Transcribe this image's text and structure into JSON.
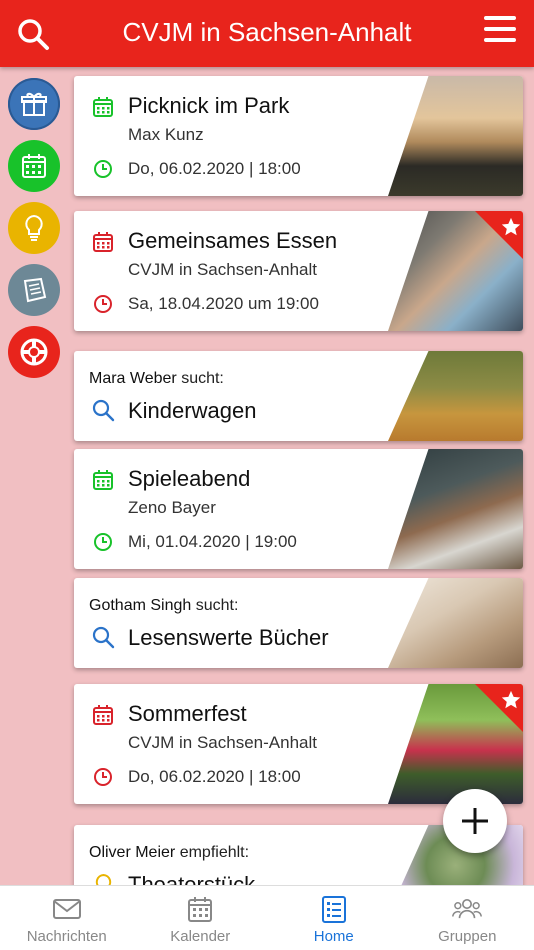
{
  "header": {
    "title": "CVJM in Sachsen-Anhalt",
    "colors": {
      "header_bg": "#e8241c",
      "background": "#f1bfc2"
    }
  },
  "sidebar": [
    {
      "name": "gift-category-button",
      "icon": "gift-icon",
      "color": "#3b74b8"
    },
    {
      "name": "calendar-category-button",
      "icon": "calendar-icon",
      "color": "#18c22a"
    },
    {
      "name": "idea-category-button",
      "icon": "lightbulb-icon",
      "color": "#e9b400"
    },
    {
      "name": "notes-category-button",
      "icon": "notes-icon",
      "color": "#6d8896"
    },
    {
      "name": "help-category-button",
      "icon": "lifebuoy-icon",
      "color": "#e8241c"
    }
  ],
  "feed": {
    "event1": {
      "title": "Picknick im Park",
      "organizer": "Max Kunz",
      "datetime": "Do, 06.02.2020 | 18:00",
      "icon_color": "#18c22a"
    },
    "event2": {
      "title": "Gemeinsames Essen",
      "organizer": "CVJM in Sachsen-Anhalt",
      "datetime": "Sa, 18.04.2020 um 19:00",
      "icon_color": "#d9232b",
      "starred": true
    },
    "search1": {
      "user": "Mara Weber",
      "action": "sucht:",
      "title": "Kinderwagen"
    },
    "event3": {
      "title": "Spieleabend",
      "organizer": "Zeno Bayer",
      "datetime": "Mi, 01.04.2020 | 19:00",
      "icon_color": "#18c22a"
    },
    "search2": {
      "user": "Gotham Singh",
      "action": "sucht:",
      "title": "Lesenswerte Bücher"
    },
    "event4": {
      "title": "Sommerfest",
      "organizer": "CVJM in Sachsen-Anhalt",
      "datetime": "Do, 06.02.2020 | 18:00",
      "icon_color": "#d9232b",
      "starred": true
    },
    "recommend1": {
      "user": "Oliver Meier",
      "action": "empfiehlt:",
      "title": "Theaterstück"
    }
  },
  "bottom_nav": [
    {
      "label": "Nachrichten",
      "icon": "envelope-icon",
      "active": false
    },
    {
      "label": "Kalender",
      "icon": "calendar-icon",
      "active": false
    },
    {
      "label": "Home",
      "icon": "list-icon",
      "active": true
    },
    {
      "label": "Gruppen",
      "icon": "people-icon",
      "active": false
    }
  ]
}
